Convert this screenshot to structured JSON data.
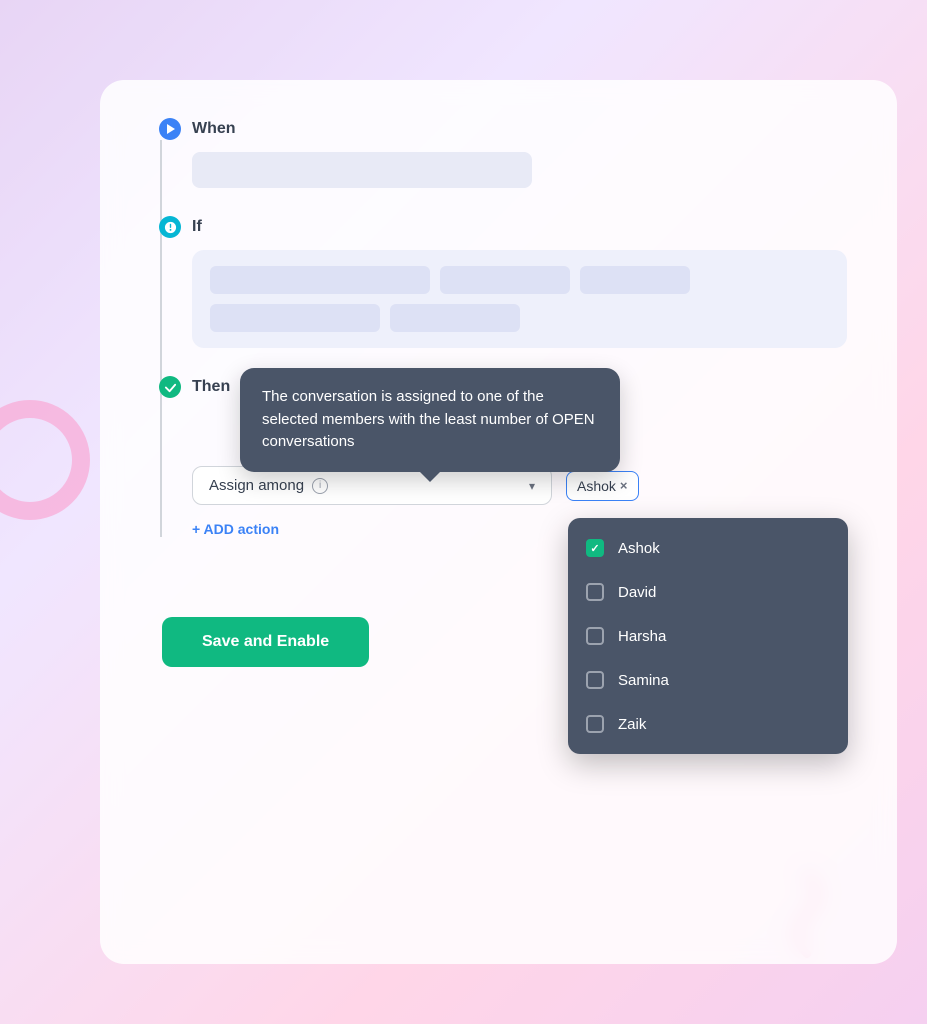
{
  "background": {
    "gradient_start": "#e8d5f5",
    "gradient_end": "#ffd6e8"
  },
  "sections": {
    "when": {
      "label": "When",
      "icon": "play-icon",
      "icon_color": "#3b82f6"
    },
    "if": {
      "label": "If",
      "icon": "gear-icon",
      "icon_color": "#06b6d4"
    },
    "then": {
      "label": "Then",
      "icon": "check-icon",
      "icon_color": "#10b981"
    }
  },
  "tooltip": {
    "text": "The conversation is assigned to one of the selected members with the least number of OPEN conversations"
  },
  "action": {
    "assign_label": "Assign among",
    "info_icon": "info-icon",
    "chevron": "▾",
    "selected_tag": "Ashok",
    "tag_close": "×"
  },
  "add_action": {
    "label": "+ ADD action"
  },
  "dropdown": {
    "items": [
      {
        "name": "Ashok",
        "checked": true
      },
      {
        "name": "David",
        "checked": false
      },
      {
        "name": "Harsha",
        "checked": false
      },
      {
        "name": "Samina",
        "checked": false
      },
      {
        "name": "Zaik",
        "checked": false
      }
    ]
  },
  "save_button": {
    "label": "Save and Enable"
  }
}
